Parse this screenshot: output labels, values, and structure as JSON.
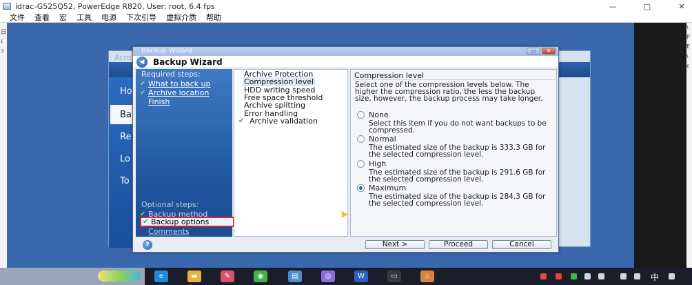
{
  "host": {
    "title": "idrac-G525Q52, PowerEdge R820, User: root, 6.4 fps",
    "controls": {
      "minimize": "—",
      "maximize": "□",
      "close": "✕"
    },
    "menu": [
      "文件",
      "查看",
      "宏",
      "工具",
      "电源",
      "下次引导",
      "虚拟介质",
      "帮助"
    ],
    "left_edge_glyphs": [
      "日",
      "ɪ",
      "ɔ"
    ],
    "right_edge_glyphs": [
      "\\",
      "P",
      "Ε",
      "\\",
      "ε"
    ]
  },
  "bg_window": {
    "title": "Acro",
    "nav": [
      "Ho",
      "Ba",
      "Re",
      "Lo",
      "To"
    ],
    "active_nav": 1
  },
  "dialog": {
    "caption": "Backup Wizard",
    "header_title": "Backup Wizard",
    "help_ctl": "▭",
    "close_ctl": "✕",
    "required_heading": "Required steps:",
    "required_steps": [
      {
        "label": "What to back up",
        "done": true
      },
      {
        "label": "Archive location",
        "done": true
      },
      {
        "label": "Finish",
        "done": false
      }
    ],
    "optional_heading": "Optional steps:",
    "optional_steps": [
      {
        "label": "Backup method",
        "done": true
      },
      {
        "label": "Backup options",
        "done": true,
        "selected": true
      },
      {
        "label": "Comments",
        "done": false
      }
    ],
    "options": [
      {
        "label": "Archive Protection",
        "current": false,
        "check": false
      },
      {
        "label": "Compression level",
        "current": true,
        "check": false
      },
      {
        "label": "HDD writing speed",
        "current": false,
        "check": false
      },
      {
        "label": "Free space threshold",
        "current": false,
        "check": false
      },
      {
        "label": "Archive splitting",
        "current": false,
        "check": false
      },
      {
        "label": "Error handling",
        "current": false,
        "check": false
      },
      {
        "label": "Archive validation",
        "current": false,
        "check": true
      }
    ],
    "detail": {
      "title": "Compression level",
      "description": "Select one of the compression levels below. The higher the compression ratio, the less the backup size, however, the backup process may take longer.",
      "levels": [
        {
          "label": "None",
          "selected": false,
          "desc": "Select this item if you do not want backups to be compressed."
        },
        {
          "label": "Normal",
          "selected": false,
          "desc": "The estimated size of the backup is 333.3 GB for the selected compression level."
        },
        {
          "label": "High",
          "selected": false,
          "desc": "The estimated size of the backup is 291.6 GB for the selected compression level."
        },
        {
          "label": "Maximum",
          "selected": true,
          "desc": "The estimated size of the backup is 284.3 GB for the selected compression level."
        }
      ]
    },
    "buttons": {
      "help": "?",
      "next": "Next >",
      "proceed": "Proceed",
      "cancel": "Cancel"
    }
  },
  "taskbar": {
    "apps": [
      {
        "name": "edge",
        "glyph": "e",
        "color": "#1f8ad8"
      },
      {
        "name": "folder",
        "glyph": "▬",
        "color": "#e3b53a"
      },
      {
        "name": "paint",
        "glyph": "✎",
        "color": "#d9546a"
      },
      {
        "name": "wechat",
        "glyph": "◉",
        "color": "#3fb54a"
      },
      {
        "name": "photos",
        "glyph": "▤",
        "color": "#4a8fd0"
      },
      {
        "name": "media",
        "glyph": "◎",
        "color": "#8a6fd8"
      },
      {
        "name": "word",
        "glyph": "W",
        "color": "#2b62c2"
      },
      {
        "name": "terminal",
        "glyph": "▭",
        "color": "#333a44"
      },
      {
        "name": "java",
        "glyph": "♨",
        "color": "#d8843a"
      }
    ],
    "ime": "中"
  }
}
